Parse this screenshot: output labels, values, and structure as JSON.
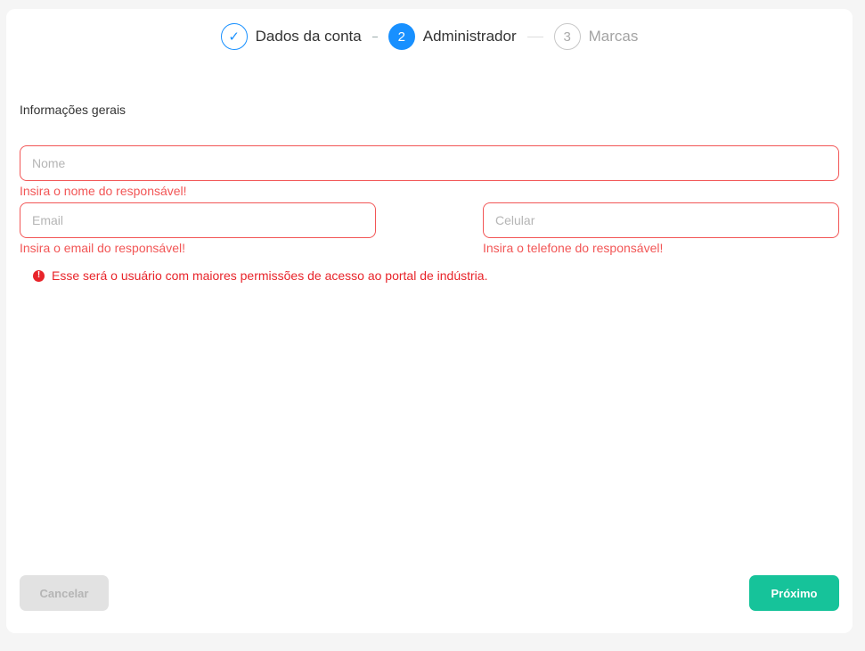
{
  "steps": [
    {
      "label": "Dados da conta",
      "marker": "✓",
      "state": "done"
    },
    {
      "label": "Administrador",
      "marker": "2",
      "state": "active"
    },
    {
      "label": "Marcas",
      "marker": "3",
      "state": "wait"
    }
  ],
  "form": {
    "section_title": "Informações gerais",
    "nome": {
      "placeholder": "Nome",
      "value": "",
      "error": "Insira o nome do responsável!"
    },
    "email": {
      "placeholder": "Email",
      "value": "",
      "error": "Insira o email do responsável!"
    },
    "celular": {
      "placeholder": "Celular",
      "value": "",
      "error": "Insira o telefone do responsável!"
    },
    "notice": "Esse será o usuário com maiores permissões de acesso ao portal de indústria."
  },
  "actions": {
    "cancel_label": "Cancelar",
    "next_label": "Próximo"
  },
  "colors": {
    "accent_blue": "#1890ff",
    "error_red": "#f25656",
    "primary_green": "#16c39a"
  }
}
